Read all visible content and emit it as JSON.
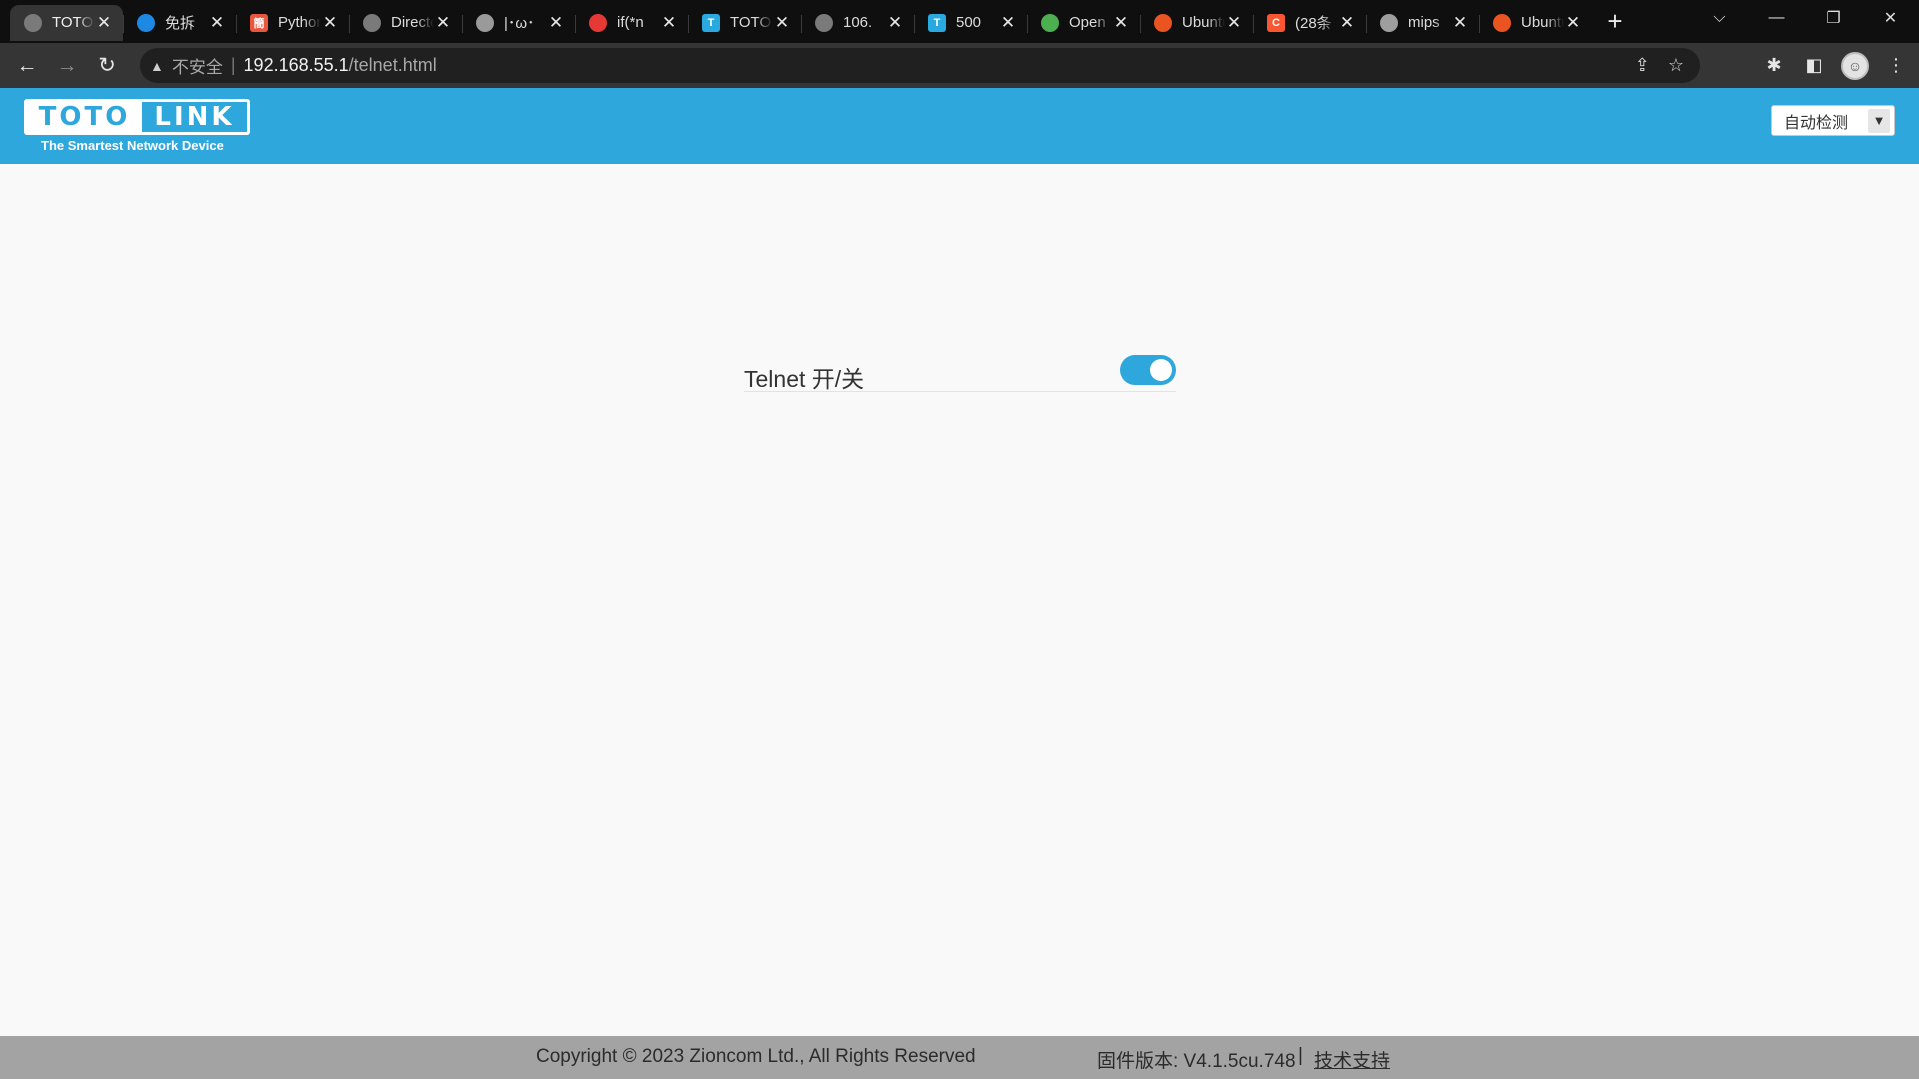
{
  "browser": {
    "tabs": [
      {
        "title": "TOTOLINK",
        "icon": "globe-icon",
        "icon_color": "#7a7a7a",
        "glyph": "",
        "active": true
      },
      {
        "title": "免拆",
        "icon": "site-icon",
        "icon_color": "#1e88e5",
        "glyph": "",
        "active": false
      },
      {
        "title": "Python",
        "icon": "jianshu-icon",
        "icon_color": "#e9573f",
        "glyph": "簡",
        "active": false
      },
      {
        "title": "Directory",
        "icon": "globe-icon",
        "icon_color": "#7a7a7a",
        "glyph": "",
        "active": false
      },
      {
        "title": "|･ω･",
        "icon": "globe-icon",
        "icon_color": "#9a9a9a",
        "glyph": "",
        "active": false
      },
      {
        "title": "if(*n",
        "icon": "site-icon",
        "icon_color": "#e53935",
        "glyph": "",
        "active": false
      },
      {
        "title": "TOTOLINK",
        "icon": "t-icon",
        "icon_color": "#29a9e0",
        "glyph": "T",
        "active": false
      },
      {
        "title": "106.",
        "icon": "globe-icon",
        "icon_color": "#7a7a7a",
        "glyph": "",
        "active": false
      },
      {
        "title": "500",
        "icon": "t-icon",
        "icon_color": "#29a9e0",
        "glyph": "T",
        "active": false
      },
      {
        "title": "Open",
        "icon": "site-icon",
        "icon_color": "#4caf50",
        "glyph": "",
        "active": false
      },
      {
        "title": "Ubuntu",
        "icon": "ubuntu-icon",
        "icon_color": "#e95420",
        "glyph": "",
        "active": false
      },
      {
        "title": "(28条",
        "icon": "csdn-icon",
        "icon_color": "#fc5531",
        "glyph": "C",
        "active": false
      },
      {
        "title": "mips",
        "icon": "site-icon",
        "icon_color": "#9e9e9e",
        "glyph": "",
        "active": false
      },
      {
        "title": "Ubuntu",
        "icon": "ubuntu-icon",
        "icon_color": "#e95420",
        "glyph": "",
        "active": false
      }
    ],
    "close_glyph": "✕",
    "new_tab_glyph": "+",
    "window_controls": {
      "tab_search": "⌵",
      "minimize": "—",
      "restore": "❐",
      "close": "✕"
    },
    "nav": {
      "back": "←",
      "forward": "→",
      "reload": "↻"
    },
    "address": {
      "warning_glyph": "▲",
      "insecure_label": "不安全",
      "separator": "|",
      "host": "192.168.55.1",
      "path": "/telnet.html"
    },
    "icons": {
      "share": "⇪",
      "bookmark": "☆",
      "extensions": "✱",
      "sidepanel": "◧",
      "menu": "⋮",
      "profile": "☺"
    }
  },
  "page": {
    "logo": {
      "part1": "TOTO",
      "part2": "LINK",
      "tagline": "The Smartest Network Device"
    },
    "language": {
      "selected": "自动检测"
    },
    "settings": {
      "telnet_label": "Telnet 开/关",
      "telnet_enabled": true
    },
    "footer": {
      "copyright": "Copyright © 2023 Zioncom Ltd., All Rights Reserved",
      "firmware": "固件版本: V4.1.5cu.748",
      "separator": "|",
      "support": "技术支持"
    }
  },
  "colors": {
    "brand": "#2ea7dd",
    "footer": "#a3a3a3",
    "page_bg": "#f9f9f9"
  }
}
